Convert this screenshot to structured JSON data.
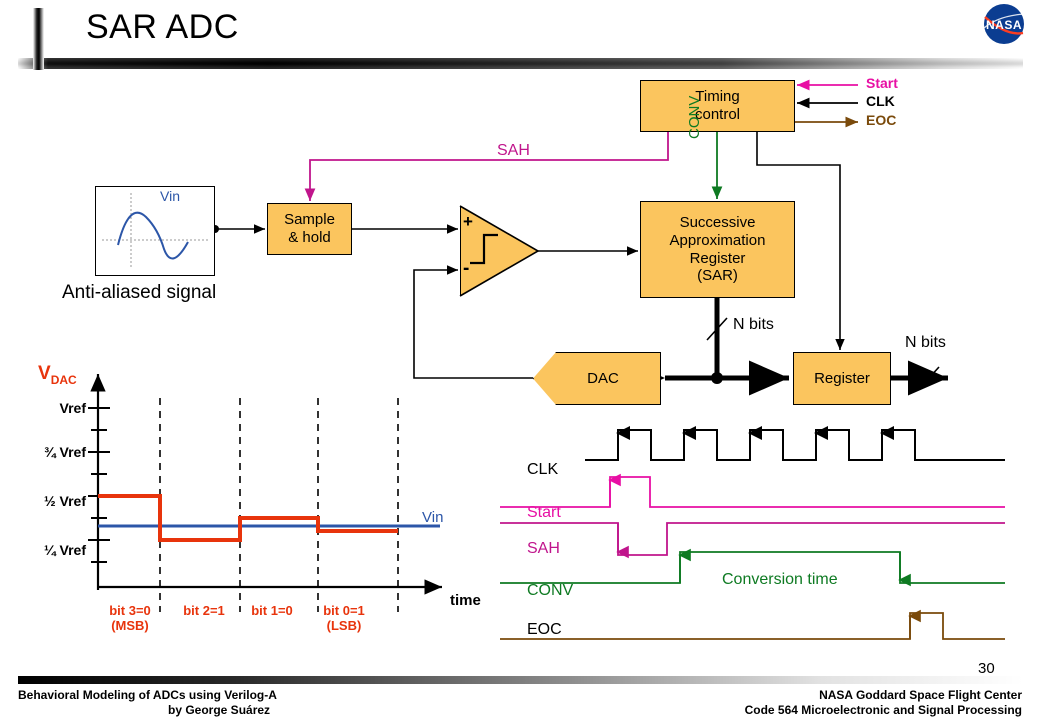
{
  "slide": {
    "title": "SAR ADC",
    "number": "30",
    "logo_name": "nasa-meatball-logo"
  },
  "diagram": {
    "blocks": {
      "timing_control": "Timing\ncontrol",
      "timing_control_l1": "Timing",
      "timing_control_l2": "control",
      "sample_hold_l1": "Sample",
      "sample_hold_l2": "& hold",
      "sar_l1": "Successive",
      "sar_l2": "Approximation",
      "sar_l3": "Register",
      "sar_l4": "(SAR)",
      "dac": "DAC",
      "register": "Register"
    },
    "comparator": {
      "plus": "+",
      "minus": "-"
    },
    "source_box": {
      "signal_label": "Vin",
      "caption": "Anti-aliased signal"
    },
    "wire_labels": {
      "sah": "SAH",
      "conv": "CONV",
      "start": "Start",
      "clk": "CLK",
      "eoc": "EOC",
      "n_bits_sar": "N bits",
      "n_bits_out": "N bits"
    },
    "colors": {
      "block_fill": "#FBC55E",
      "sah_wire": "#C0158C",
      "conv_wire": "#0E7A22",
      "start_wire": "#E80FA4",
      "eoc_wire": "#7A4A0B",
      "vin_trace": "#2C56A8",
      "vdac_trace": "#E8340C"
    }
  },
  "chart_data": {
    "type": "line",
    "title": "",
    "ylabel": "V_DAC",
    "xlabel": "time",
    "ylabel_sub": "DAC",
    "ylabel_main": "V",
    "ytick_labels": [
      "Vref",
      "¾ Vref",
      "½ Vref",
      "¼ Vref"
    ],
    "ytick_values": [
      1.0,
      0.75,
      0.5,
      0.25
    ],
    "ytick_minor_values": [
      0.875,
      0.625,
      0.375,
      0.125
    ],
    "ylim": [
      0,
      1.12
    ],
    "xlim": [
      0,
      4
    ],
    "grid": false,
    "series": [
      {
        "name": "V_DAC",
        "color": "#E8340C",
        "style": "step",
        "x": [
          0,
          1,
          1,
          2,
          2,
          3,
          3,
          4
        ],
        "values": [
          0.5,
          0.5,
          0.25,
          0.25,
          0.3125,
          0.3125,
          0.28125,
          0.28125
        ]
      },
      {
        "name": "Vin",
        "color": "#2C56A8",
        "style": "line",
        "x": [
          0,
          4
        ],
        "values": [
          0.296875,
          0.296875
        ]
      }
    ],
    "annotations": [
      {
        "text": "Vin",
        "color": "#2C56A8"
      },
      {
        "text": "bit 3=0",
        "sub": "(MSB)",
        "x_interval": [
          0,
          1
        ]
      },
      {
        "text": "bit 2=1",
        "sub": "",
        "x_interval": [
          1,
          2
        ]
      },
      {
        "text": "bit 1=0",
        "sub": "",
        "x_interval": [
          2,
          3
        ]
      },
      {
        "text": "bit 0=1",
        "sub": "(LSB)",
        "x_interval": [
          3,
          4
        ]
      }
    ],
    "bit_labels": [
      {
        "main": "bit 3=0",
        "sub": "(MSB)"
      },
      {
        "main": "bit 2=1",
        "sub": ""
      },
      {
        "main": "bit 1=0",
        "sub": ""
      },
      {
        "main": "bit 0=1",
        "sub": "(LSB)"
      }
    ],
    "result_code": "0101"
  },
  "timing": {
    "signals": [
      {
        "name": "CLK",
        "label": "CLK",
        "color": "#000000",
        "pulses": 5,
        "edge_arrows": "rising"
      },
      {
        "name": "Start",
        "label": "Start",
        "color": "#E80FA4",
        "pulses": 1,
        "edge_arrows": "rising"
      },
      {
        "name": "SAH",
        "label": "SAH",
        "color": "#C0158C",
        "pulses": 1,
        "edge_arrows": "falling"
      },
      {
        "name": "CONV",
        "label": "CONV",
        "color": "#0E7A22",
        "pulses": 1,
        "edge_arrows": "both"
      },
      {
        "name": "EOC",
        "label": "EOC",
        "color": "#7A4A0B",
        "pulses": 1,
        "edge_arrows": "rising"
      }
    ],
    "conversion_label": "Conversion time"
  },
  "footer": {
    "left_line1": "Behavioral Modeling of ADCs using Verilog-A",
    "left_line2": "by George Suárez",
    "right_line1": "NASA Goddard Space Flight Center",
    "right_line2": "Code 564 Microelectronic and Signal Processing"
  }
}
